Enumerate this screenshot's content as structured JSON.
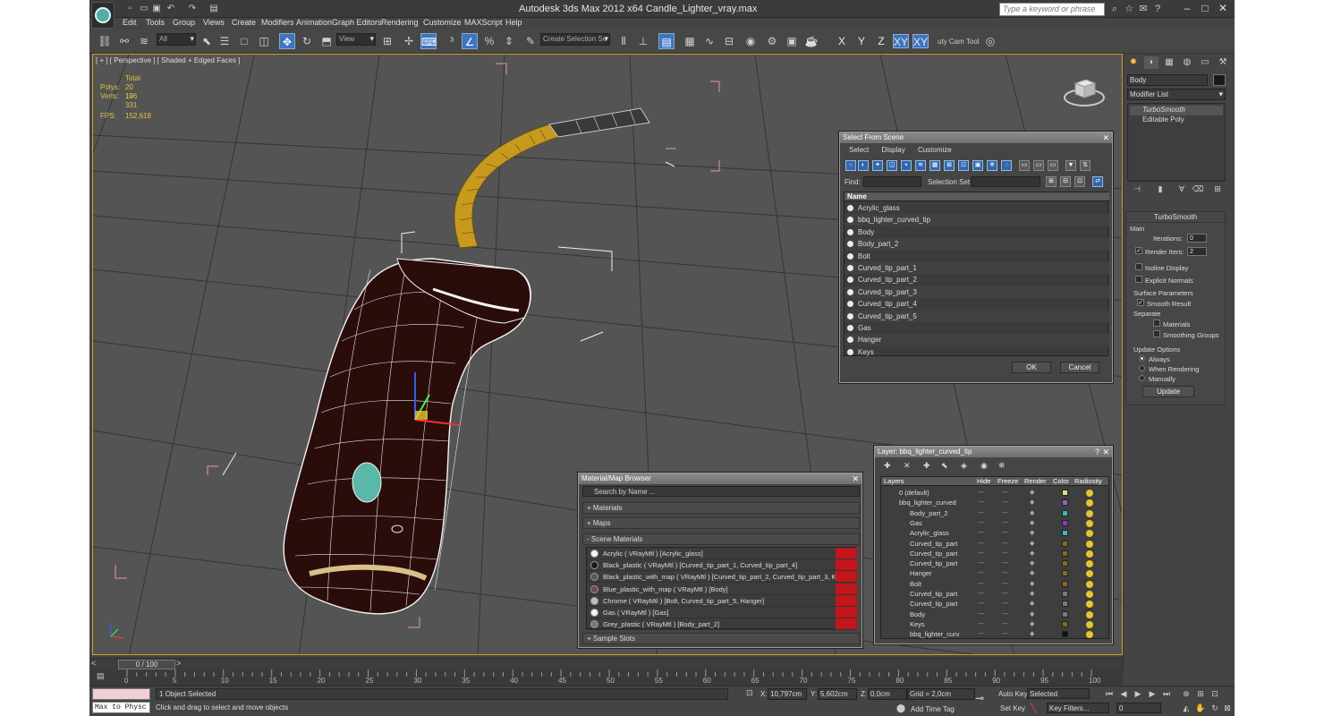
{
  "window": {
    "title": "Autodesk 3ds Max  2012 x64     Candle_Lighter_vray.max",
    "search_placeholder": "Type a keyword or phrase"
  },
  "menu": [
    "Edit",
    "Tools",
    "Group",
    "Views",
    "Create",
    "Modifiers",
    "Animation",
    "Graph Editors",
    "Rendering",
    "Customize",
    "MAXScript",
    "Help"
  ],
  "toolbar": {
    "filter_value": "All",
    "refcoord_value": "View",
    "selection_set_placeholder": "Create Selection Se",
    "axis_labels": [
      "X",
      "Y",
      "Z",
      "XY",
      "XY"
    ],
    "cam_tool_label": "uty Cam Tool"
  },
  "viewport": {
    "label": "[ + ] [ Perspective ] [ Shaded + Edged Faces ]",
    "stats": {
      "total_label": "Total",
      "polys_label": "Polys:",
      "polys": "20 196",
      "verts_label": "Verts:",
      "verts": "10 331",
      "fps_label": "FPS:",
      "fps": "152,618"
    }
  },
  "command_panel": {
    "object_name": "Body",
    "modifier_list": "Modifier List",
    "stack": [
      "TurboSmooth",
      "Editable Poly"
    ],
    "rollout_title": "TurboSmooth",
    "main_label": "Main",
    "iterations_label": "Iterations:",
    "iterations": "0",
    "render_iters_label": "Render Iters:",
    "render_iters": "2",
    "isoline_label": "Isoline Display",
    "explicit_normals_label": "Explicit Normals",
    "surface_params_label": "Surface Parameters",
    "smooth_result_label": "Smooth Result",
    "separate_label": "Separate",
    "materials_label": "Materials",
    "smoothing_groups_label": "Smoothing Groups",
    "update_options_label": "Update Options",
    "always_label": "Always",
    "when_rendering_label": "When Rendering",
    "manually_label": "Manually",
    "update_button": "Update"
  },
  "select_from_scene": {
    "title": "Select From Scene",
    "menu": [
      "Select",
      "Display",
      "Customize"
    ],
    "find_label": "Find:",
    "selection_set_label": "Selection Set:",
    "column_name": "Name",
    "items": [
      "Acrylic_glass",
      "bbq_lighter_curved_tip",
      "Body",
      "Body_part_2",
      "Bolt",
      "Curved_tip_part_1",
      "Curved_tip_part_2",
      "Curved_tip_part_3",
      "Curved_tip_part_4",
      "Curved_tip_part_5",
      "Gas",
      "Hanger",
      "Keys"
    ],
    "ok": "OK",
    "cancel": "Cancel"
  },
  "material_browser": {
    "title": "Material/Map Browser",
    "search_placeholder": "Search by Name ...",
    "sections": [
      "+ Materials",
      "+ Maps",
      "- Scene Materials",
      "+ Sample Slots"
    ],
    "materials": [
      {
        "label": "Acrylic  ( VRayMtl )  [Acrylic_glass]",
        "swatch": "#f2f2f2"
      },
      {
        "label": "Black_plastic  ( VRayMtl )  [Curved_tip_part_1, Curved_tip_part_4]",
        "swatch": "#1b1b1b"
      },
      {
        "label": "Black_plastic_with_map  ( VRayMtl )  [Curved_tip_part_2, Curved_tip_part_3, Ke...",
        "swatch": "#5a5a5a"
      },
      {
        "label": "Blue_plastic_with_map  ( VRayMtl )  [Body]",
        "swatch": "#6b4f4f"
      },
      {
        "label": "Chrome  ( VRayMtl )  [Bolt, Curved_tip_part_5, Hanger]",
        "swatch": "#bdbdbd"
      },
      {
        "label": "Gas  ( VRayMtl )  [Gas]",
        "swatch": "#f2f2f2"
      },
      {
        "label": "Grey_plastic  ( VRayMtl )  [Body_part_2]",
        "swatch": "#7a7a7a"
      }
    ]
  },
  "layer_dialog": {
    "title": "Layer: bbq_lighter_curved_tip",
    "columns": [
      "Layers",
      "Hide",
      "Freeze",
      "Render",
      "Color",
      "Radiosity"
    ],
    "rows": [
      {
        "name": "0 (default)",
        "color": "#e8e070"
      },
      {
        "name": "bbq_lighter_curved",
        "color": "#9a5ec8"
      },
      {
        "name": "Body_part_2",
        "color": "#3cb8b0"
      },
      {
        "name": "Gas",
        "color": "#8a3cc8"
      },
      {
        "name": "Acrylic_glass",
        "color": "#38c0b8"
      },
      {
        "name": "Curved_tip_part",
        "color": "#8a6a18"
      },
      {
        "name": "Curved_tip_part",
        "color": "#8a6a18"
      },
      {
        "name": "Curved_tip_part",
        "color": "#8a6a18"
      },
      {
        "name": "Hanger",
        "color": "#8a6a18"
      },
      {
        "name": "Bolt",
        "color": "#8a6a18"
      },
      {
        "name": "Curved_tip_part",
        "color": "#7a7a7a"
      },
      {
        "name": "Curved_tip_part",
        "color": "#7a7a7a"
      },
      {
        "name": "Body",
        "color": "#7a7a7a"
      },
      {
        "name": "Keys",
        "color": "#8a6a18"
      },
      {
        "name": "bbq_lighter_curv",
        "color": "#111111"
      }
    ]
  },
  "timeline": {
    "frame": "0 / 100",
    "ticks": [
      "0",
      "5",
      "10",
      "15",
      "20",
      "25",
      "30",
      "35",
      "40",
      "45",
      "50",
      "55",
      "60",
      "65",
      "70",
      "75",
      "80",
      "85",
      "90",
      "95",
      "100"
    ]
  },
  "status": {
    "maxscript": "Max to Physc",
    "selected": "1 Object Selected",
    "prompt": "Click and drag to select and move objects",
    "x_label": "X:",
    "x": "10,797cm",
    "y_label": "Y:",
    "y": "5,602cm",
    "z_label": "Z:",
    "z": "0,0cm",
    "grid": "Grid = 2,0cm",
    "add_time_tag": "Add Time Tag",
    "auto_key": "Auto Key",
    "set_key": "Set Key",
    "selected_mode": "Selected",
    "key_filters": "Key Filters...",
    "frame_value": "0"
  }
}
